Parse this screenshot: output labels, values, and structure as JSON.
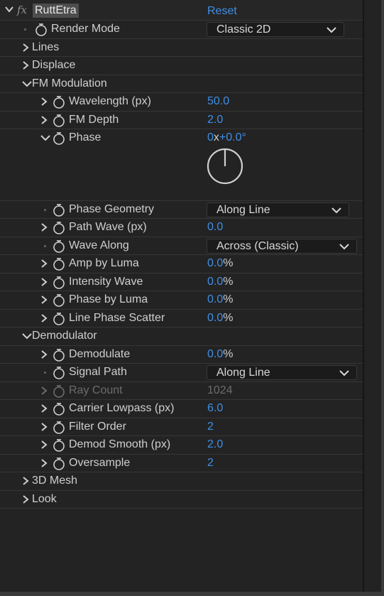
{
  "effect": {
    "fx_label": "fx",
    "name": "RuttEtra",
    "reset_label": "Reset"
  },
  "render_mode": {
    "label": "Render Mode",
    "value": "Classic 2D"
  },
  "groups": {
    "lines": "Lines",
    "displace": "Displace",
    "fm_modulation": "FM Modulation",
    "demodulator": "Demodulator",
    "mesh_3d": "3D Mesh",
    "look": "Look"
  },
  "fm": {
    "wavelength": {
      "label": "Wavelength (px)",
      "value": "50.0"
    },
    "fm_depth": {
      "label": "FM Depth",
      "value": "2.0"
    },
    "phase": {
      "label": "Phase",
      "turns": "0",
      "x": "x",
      "degrees": "+0.0°"
    },
    "phase_geometry": {
      "label": "Phase Geometry",
      "value": "Along Line"
    },
    "path_wave": {
      "label": "Path Wave (px)",
      "value": "0.0"
    },
    "wave_along": {
      "label": "Wave Along",
      "value": "Across (Classic)"
    },
    "amp_by_luma": {
      "label": "Amp by Luma",
      "value": "0.0",
      "unit": "%"
    },
    "intensity_wave": {
      "label": "Intensity Wave",
      "value": "0.0",
      "unit": "%"
    },
    "phase_by_luma": {
      "label": "Phase by Luma",
      "value": "0.0",
      "unit": "%"
    },
    "line_phase_scatter": {
      "label": "Line Phase Scatter",
      "value": "0.0",
      "unit": "%"
    }
  },
  "demod": {
    "demodulate": {
      "label": "Demodulate",
      "value": "0.0",
      "unit": "%"
    },
    "signal_path": {
      "label": "Signal Path",
      "value": "Along Line"
    },
    "ray_count": {
      "label": "Ray Count",
      "value": "1024"
    },
    "carrier_lowpass": {
      "label": "Carrier Lowpass (px)",
      "value": "6.0"
    },
    "filter_order": {
      "label": "Filter Order",
      "value": "2"
    },
    "demod_smooth": {
      "label": "Demod Smooth (px)",
      "value": "2.0"
    },
    "oversample": {
      "label": "Oversample",
      "value": "2"
    }
  },
  "colors": {
    "value_blue": "#3f8fe6",
    "background": "#232323",
    "text": "#cfcfcf",
    "disabled": "#6c6c6c"
  }
}
